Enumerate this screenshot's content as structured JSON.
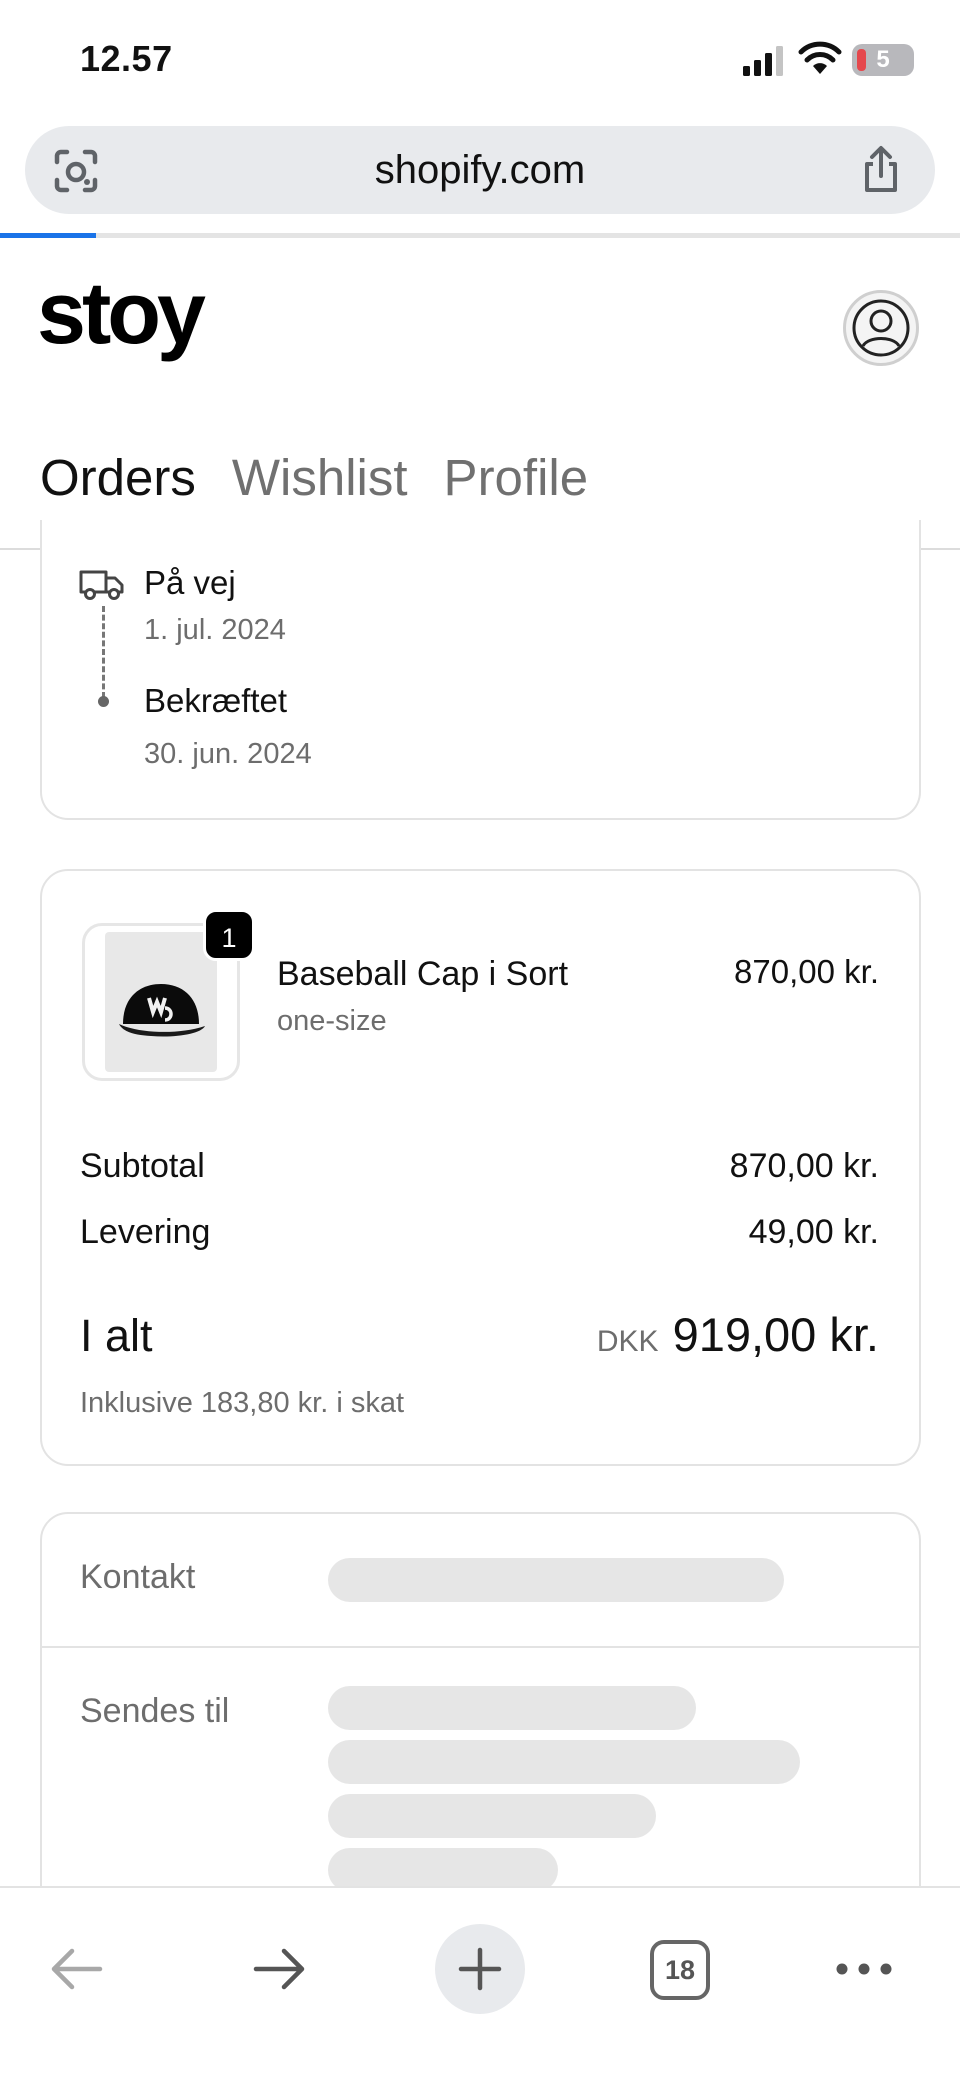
{
  "status_bar": {
    "time": "12.57",
    "battery_level": "5"
  },
  "browser": {
    "url": "shopify.com",
    "load_progress": 0.1,
    "open_tabs": "18"
  },
  "shop": {
    "logo": "stoy",
    "tabs": [
      {
        "label": "Orders",
        "active": true
      },
      {
        "label": "Wishlist",
        "active": false
      },
      {
        "label": "Profile",
        "active": false
      }
    ]
  },
  "order_status": {
    "steps": [
      {
        "label": "På vej",
        "date": "1. jul. 2024",
        "icon": "truck-icon"
      },
      {
        "label": "Bekræftet",
        "date": "30. jun. 2024",
        "icon": "dot"
      }
    ]
  },
  "order_summary": {
    "item": {
      "quantity": "1",
      "name": "Baseball Cap i Sort",
      "variant": "one-size",
      "price": "870,00 kr."
    },
    "subtotal_label": "Subtotal",
    "subtotal_value": "870,00 kr.",
    "shipping_label": "Levering",
    "shipping_value": "49,00 kr.",
    "total_label": "I alt",
    "total_currency": "DKK",
    "total_value": "919,00 kr.",
    "tax_note": "Inklusive 183,80 kr. i skat"
  },
  "details": {
    "contact_label": "Kontakt",
    "shipping_to_label": "Sendes til"
  },
  "colors": {
    "accent": "#1a73e8",
    "badge": "#000000",
    "muted_text": "#6d6d6d",
    "skeleton": "#e6e6e6"
  }
}
